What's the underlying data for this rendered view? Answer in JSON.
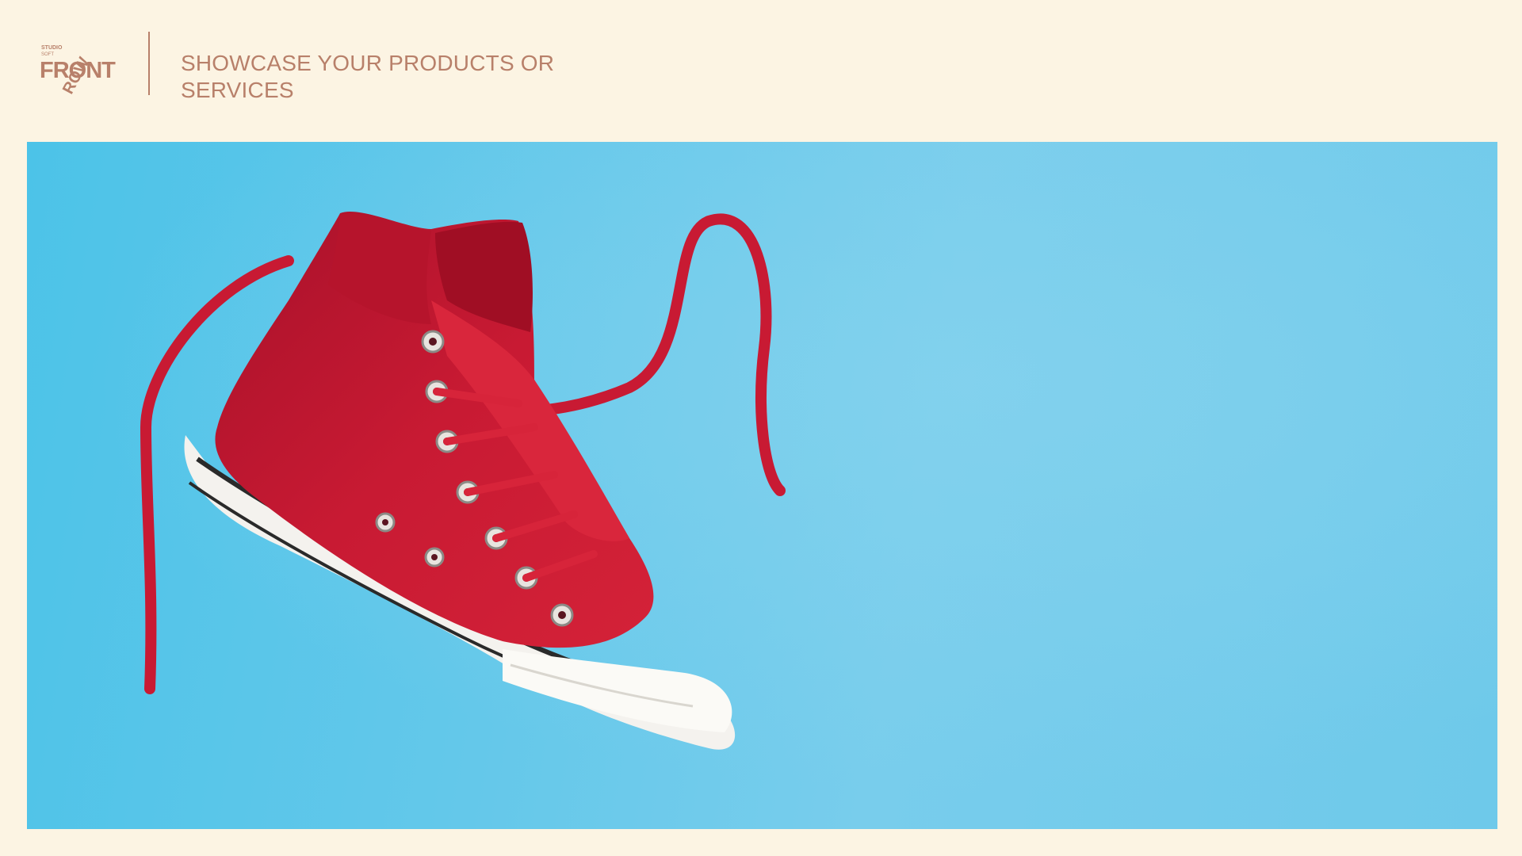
{
  "slide": {
    "title": "SHOWCASE YOUR PRODUCTS OR SERVICES"
  },
  "logo": {
    "line1": "STUDIO",
    "line2": "SOFT",
    "wordmark_front": "FRONT",
    "wordmark_row": "ROW"
  },
  "colors": {
    "background": "#fcf4e3",
    "accent": "#b8806a",
    "photo_sky": "#64c8ea",
    "shoe_red": "#c2182e"
  },
  "photo": {
    "subject": "red-high-top-sneaker"
  }
}
